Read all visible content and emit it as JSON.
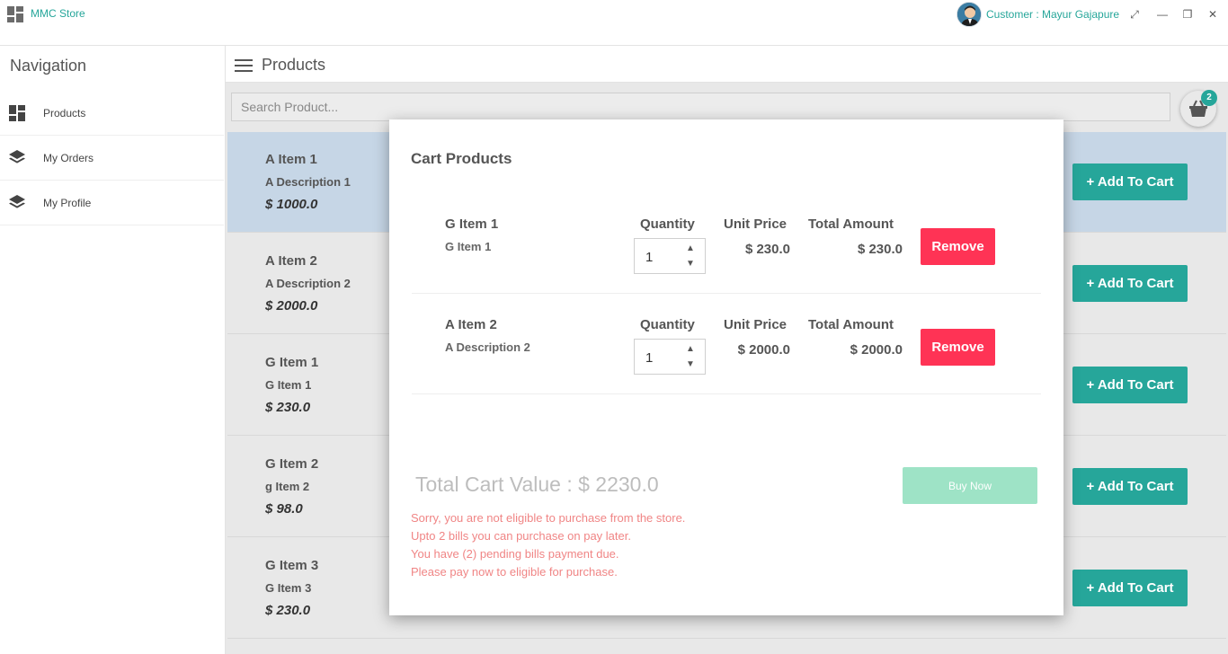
{
  "app": {
    "title": "MMC Store",
    "user_label": "Customer : Mayur Gajapure",
    "accent": "#26a69a"
  },
  "window_controls": [
    {
      "name": "maximize-arrows-icon",
      "glyph": "⤢"
    },
    {
      "name": "minimize-icon",
      "glyph": "—"
    },
    {
      "name": "restore-icon",
      "glyph": "❐"
    },
    {
      "name": "close-icon",
      "glyph": "✕"
    }
  ],
  "sidebar": {
    "title": "Navigation",
    "items": [
      {
        "label": "Products",
        "icon": "dashboard-icon"
      },
      {
        "label": "My Orders",
        "icon": "layers-icon"
      },
      {
        "label": "My Profile",
        "icon": "layers-icon"
      }
    ]
  },
  "header": {
    "title": "Products"
  },
  "search": {
    "placeholder": "Search Product..."
  },
  "cart": {
    "badge_count": "2",
    "icon": "shopping-basket-icon"
  },
  "products": [
    {
      "name": "A Item 1",
      "description": "A Description 1",
      "price": "$ 1000.0",
      "button": "+ Add To Cart",
      "selected": true
    },
    {
      "name": "A Item 2",
      "description": "A Description 2",
      "price": "$ 2000.0",
      "button": "+ Add To Cart",
      "selected": false
    },
    {
      "name": "G Item 1",
      "description": "G Item 1",
      "price": "$ 230.0",
      "button": "+ Add To Cart",
      "selected": false
    },
    {
      "name": "G Item 2",
      "description": "g Item 2",
      "price": "$ 98.0",
      "button": "+ Add To Cart",
      "selected": false
    },
    {
      "name": "G Item 3",
      "description": "G Item 3",
      "price": "$ 230.0",
      "button": "+ Add To Cart",
      "selected": false
    }
  ],
  "modal": {
    "title": "Cart Products",
    "items": [
      {
        "name": "G Item 1",
        "description": "G Item 1",
        "quantity_label": "Quantity",
        "quantity": "1",
        "unit_price_label": "Unit Price",
        "unit_price": "$ 230.0",
        "total_label": "Total Amount",
        "total": "$ 230.0",
        "remove_label": "Remove"
      },
      {
        "name": "A Item 2",
        "description": "A Description 2",
        "quantity_label": "Quantity",
        "quantity": "1",
        "unit_price_label": "Unit Price",
        "unit_price": "$ 2000.0",
        "total_label": "Total Amount",
        "total": "$ 2000.0",
        "remove_label": "Remove"
      }
    ],
    "total_value": "Total Cart Value : $ 2230.0",
    "buy_label": "Buy Now",
    "messages": [
      "Sorry, you are not eligible to purchase from the store.",
      "Upto 2 bills you can purchase on pay later.",
      "You have (2) pending bills payment due.",
      "Please pay now to eligible for purchase."
    ],
    "colors": {
      "remove": "#ff3355",
      "buy_disabled": "#9ee3c6",
      "warning_text": "#f08585"
    }
  }
}
